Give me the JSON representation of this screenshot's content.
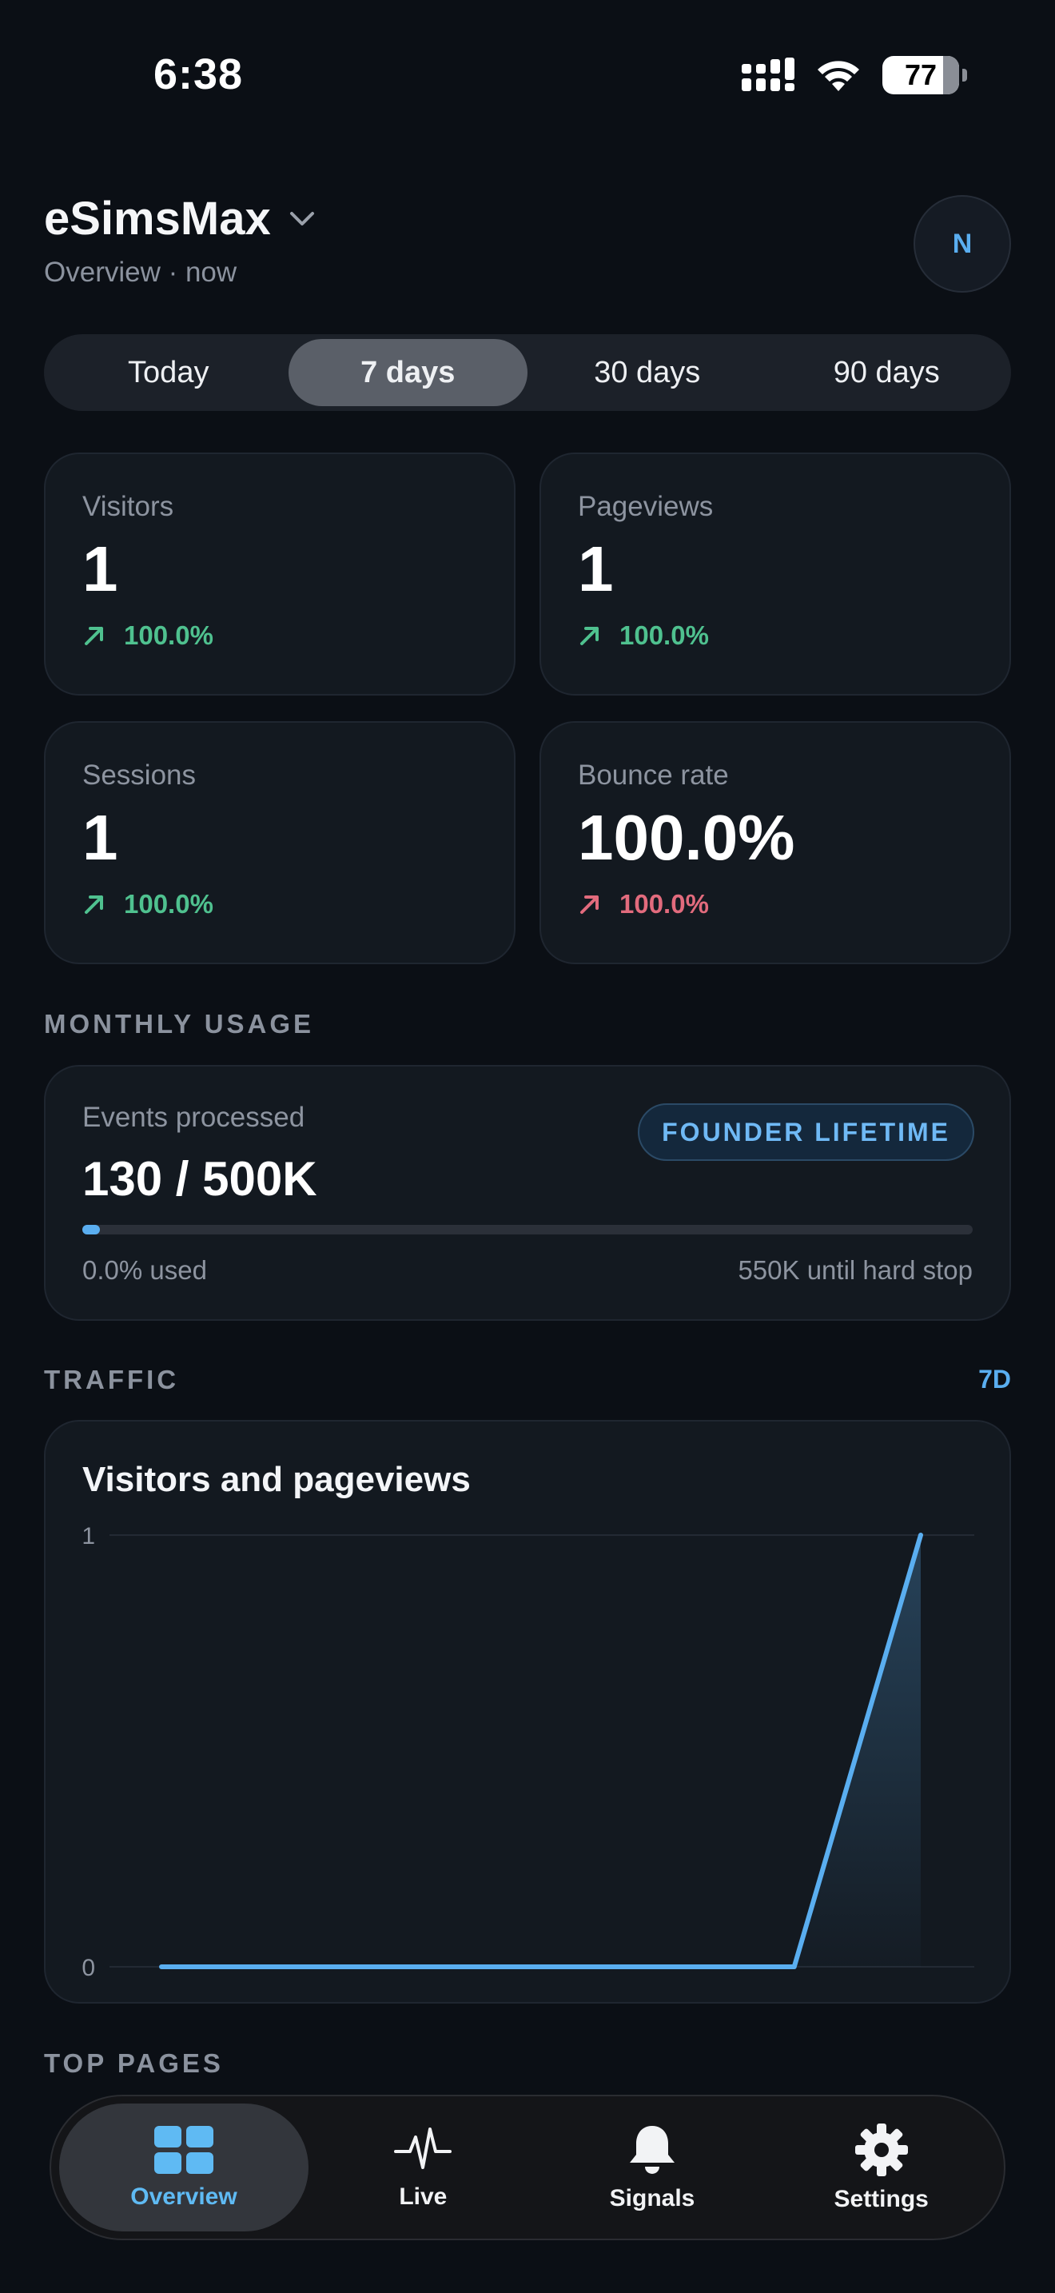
{
  "status": {
    "time": "6:38",
    "battery": "77"
  },
  "header": {
    "app_name": "eSimsMax",
    "subtitle": "Overview · now",
    "avatar_initial": "N"
  },
  "ranges": [
    "Today",
    "7 days",
    "30 days",
    "90 days"
  ],
  "active_range": "7 days",
  "stats": [
    {
      "label": "Visitors",
      "value": "1",
      "delta": "100.0%",
      "trend": "up-good"
    },
    {
      "label": "Pageviews",
      "value": "1",
      "delta": "100.0%",
      "trend": "up-good"
    },
    {
      "label": "Sessions",
      "value": "1",
      "delta": "100.0%",
      "trend": "up-good"
    },
    {
      "label": "Bounce rate",
      "value": "100.0%",
      "delta": "100.0%",
      "trend": "up-bad"
    }
  ],
  "usage": {
    "section_label": "MONTHLY USAGE",
    "label": "Events processed",
    "value": "130 / 500K",
    "badge": "FOUNDER LIFETIME",
    "progress_fraction": 0.02,
    "used_text": "0.0% used",
    "limit_text": "550K until hard stop"
  },
  "traffic": {
    "section_label": "TRAFFIC",
    "range_link": "7D"
  },
  "chart_data": {
    "type": "line",
    "title": "Visitors and pageviews",
    "x": [
      0,
      1,
      2,
      3,
      4,
      5,
      6
    ],
    "series": [
      {
        "values": [
          0,
          0,
          0,
          0,
          0,
          0,
          1
        ]
      }
    ],
    "ylim": [
      0,
      1
    ],
    "yticks": [
      "0",
      "1"
    ],
    "grid": true,
    "color": "#5aaef0"
  },
  "top_pages": {
    "section_label": "TOP PAGES"
  },
  "tabs": [
    {
      "label": "Overview",
      "icon": "grid-icon",
      "active": true
    },
    {
      "label": "Live",
      "icon": "pulse-icon",
      "active": false
    },
    {
      "label": "Signals",
      "icon": "bell-icon",
      "active": false
    },
    {
      "label": "Settings",
      "icon": "gear-icon",
      "active": false
    }
  ],
  "colors": {
    "accent": "#5aaef0",
    "good": "#4fc18f",
    "bad": "#e26b7d",
    "background": "#0b0f15"
  }
}
